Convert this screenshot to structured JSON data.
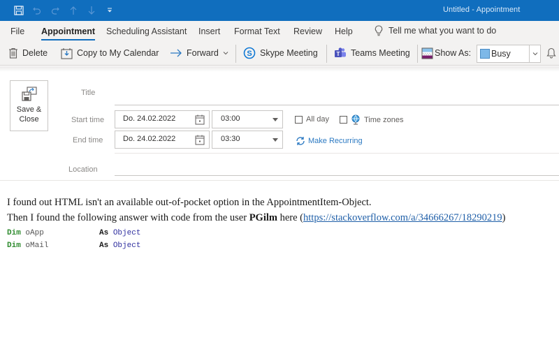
{
  "window": {
    "title": "Untitled  -  Appointment"
  },
  "quick_access": [
    {
      "icon": "save-icon"
    },
    {
      "icon": "undo-icon"
    },
    {
      "icon": "redo-icon"
    },
    {
      "icon": "up-arrow-icon"
    },
    {
      "icon": "down-arrow-icon"
    },
    {
      "icon": "customize-qat-icon"
    }
  ],
  "menu": {
    "tabs": [
      {
        "label": "File"
      },
      {
        "label": "Appointment"
      },
      {
        "label": "Scheduling Assistant"
      },
      {
        "label": "Insert"
      },
      {
        "label": "Format Text"
      },
      {
        "label": "Review"
      },
      {
        "label": "Help"
      }
    ],
    "active_tab": "Appointment",
    "tell_me": "Tell me what you want to do"
  },
  "ribbon": {
    "delete": "Delete",
    "copy_to_calendar": "Copy to My Calendar",
    "forward": "Forward",
    "skype_meeting": "Skype Meeting",
    "teams_meeting": "Teams Meeting",
    "show_as_label": "Show As:",
    "show_as_value": "Busy",
    "colors": {
      "accent": "#106ebe",
      "busy": "#7db8e8"
    }
  },
  "form": {
    "save_close_label": "Save & Close",
    "title_label": "Title",
    "title_value": "",
    "start_label": "Start time",
    "start_date": "Do. 24.02.2022",
    "start_time": "03:00",
    "end_label": "End time",
    "end_date": "Do. 24.02.2022",
    "end_time": "03:30",
    "all_day_label": "All day",
    "all_day_checked": false,
    "time_zones_label": "Time zones",
    "time_zones_checked": false,
    "make_recurring": "Make Recurring",
    "location_label": "Location",
    "location_value": ""
  },
  "body": {
    "para1": "I found out HTML isn't an available out-of-pocket option in the AppointmentItem-Object.",
    "para2_pre": "Then I found the following answer with code from the user ",
    "para2_user": "PGilm",
    "para2_mid": " here (",
    "para2_link": "https://stackoverflow.com/a/34666267/18290219",
    "para2_post": ")",
    "code": [
      {
        "kw": "Dim",
        "name": " oApp            ",
        "as": "As",
        "type": " Object"
      },
      {
        "kw": "Dim",
        "name": " oMail           ",
        "as": "As",
        "type": " Object"
      }
    ]
  }
}
